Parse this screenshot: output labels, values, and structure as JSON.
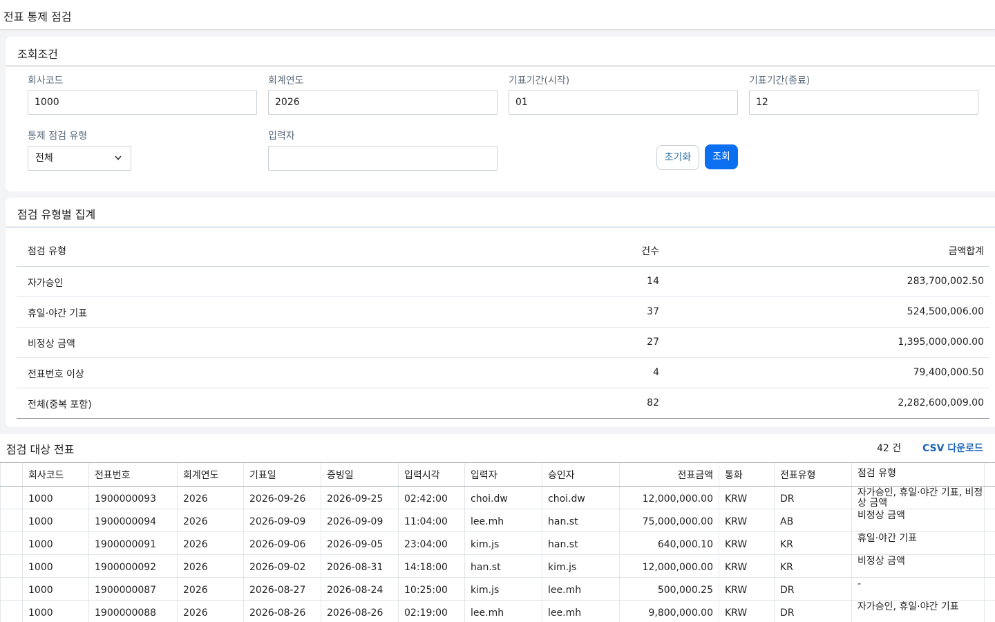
{
  "page": {
    "title": "전표 통제 점검"
  },
  "search": {
    "title": "조회조건",
    "company_code": {
      "label": "회사코드",
      "value": "1000"
    },
    "fiscal_year": {
      "label": "회계연도",
      "value": "2026"
    },
    "period_from": {
      "label": "기표기간(시작)",
      "value": "01"
    },
    "period_to": {
      "label": "기표기간(종료)",
      "value": "12"
    },
    "check_type": {
      "label": "통제 점검 유형",
      "value": "전체",
      "icon": "chevron-down-icon"
    },
    "entered_by": {
      "label": "입력자",
      "value": ""
    },
    "reset_label": "초기화",
    "search_label": "조회"
  },
  "summary": {
    "title": "점검 유형별 집계",
    "headers": [
      "점검 유형",
      "건수",
      "금액합계"
    ],
    "rows": [
      {
        "type": "자가승인",
        "count": "14",
        "amount": "283,700,002.50"
      },
      {
        "type": "휴일·야간 기표",
        "count": "37",
        "amount": "524,500,006.00"
      },
      {
        "type": "비정상 금액",
        "count": "27",
        "amount": "1,395,000,000.00"
      },
      {
        "type": "전표번호 이상",
        "count": "4",
        "amount": "79,400,000.50"
      },
      {
        "type": "전체(중복 포함)",
        "count": "82",
        "amount": "2,282,600,009.00"
      }
    ]
  },
  "list": {
    "title": "점검 대상 전표",
    "count": "42 건",
    "csv_label": "CSV 다운로드",
    "headers": [
      "회사코드",
      "전표번호",
      "회계연도",
      "기표일",
      "증빙일",
      "입력시각",
      "입력자",
      "승인자",
      "전표금액",
      "통화",
      "전표유형",
      "점검 유형"
    ],
    "rows": [
      [
        "1000",
        "1900000093",
        "2026",
        "2026-09-26",
        "2026-09-25",
        "02:42:00",
        "choi.dw",
        "choi.dw",
        "12,000,000.00",
        "KRW",
        "DR",
        "자가승인, 휴일·야간 기표, 비정상 금액"
      ],
      [
        "1000",
        "1900000094",
        "2026",
        "2026-09-09",
        "2026-09-09",
        "11:04:00",
        "lee.mh",
        "han.st",
        "75,000,000.00",
        "KRW",
        "AB",
        "비정상 금액"
      ],
      [
        "1000",
        "1900000091",
        "2026",
        "2026-09-06",
        "2026-09-05",
        "23:04:00",
        "kim.js",
        "han.st",
        "640,000.10",
        "KRW",
        "KR",
        "휴일·야간 기표"
      ],
      [
        "1000",
        "1900000092",
        "2026",
        "2026-09-02",
        "2026-08-31",
        "14:18:00",
        "han.st",
        "kim.js",
        "12,000,000.00",
        "KRW",
        "KR",
        "비정상 금액"
      ],
      [
        "1000",
        "1900000087",
        "2026",
        "2026-08-27",
        "2026-08-24",
        "10:25:00",
        "kim.js",
        "lee.mh",
        "500,000.25",
        "KRW",
        "DR",
        "-"
      ],
      [
        "1000",
        "1900000088",
        "2026",
        "2026-08-26",
        "2026-08-26",
        "02:19:00",
        "lee.mh",
        "lee.mh",
        "9,800,000.00",
        "KRW",
        "DR",
        "자가승인, 휴일·야간 기표"
      ]
    ]
  }
}
